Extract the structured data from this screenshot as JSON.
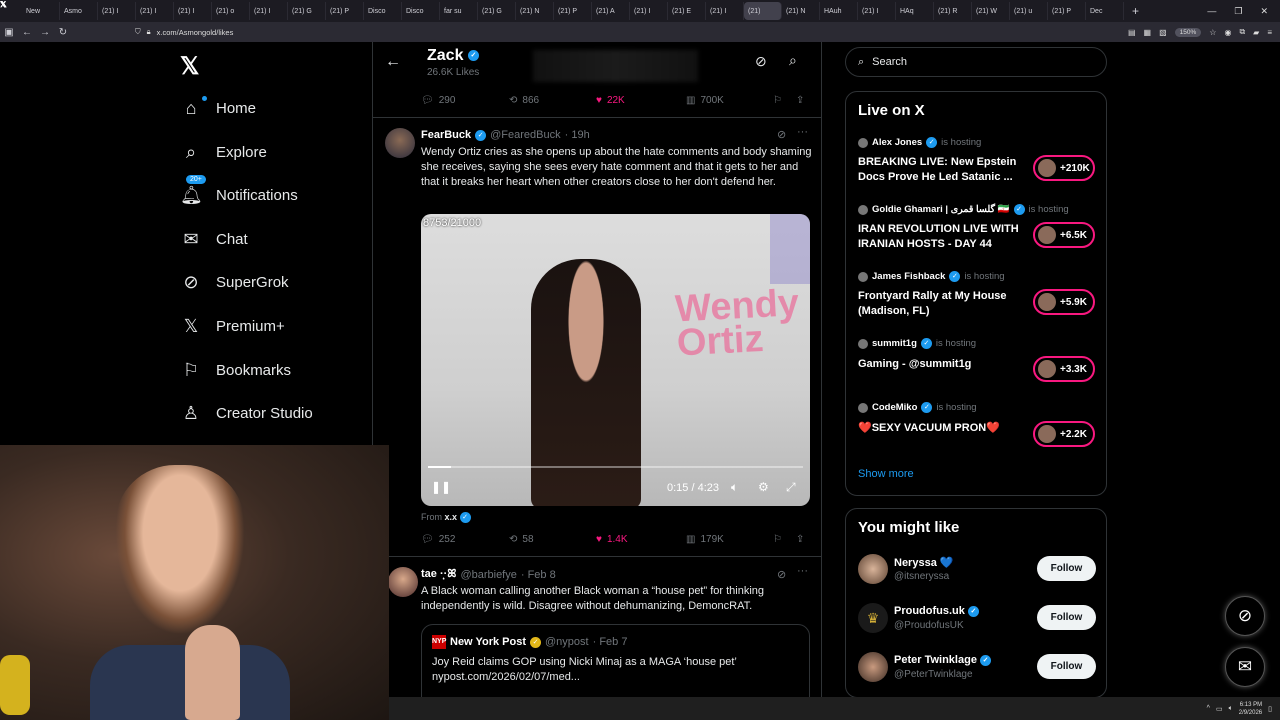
{
  "browser": {
    "tabs": [
      "New",
      "Asmo",
      "(21) I",
      "(21) I",
      "(21) I",
      "(21) o",
      "(21) I",
      "(21) G",
      "(21) P",
      "Disco",
      "Disco",
      "far su",
      "(21) G",
      "(21) N",
      "(21) P",
      "(21) A",
      "(21) I",
      "(21) E",
      "(21) I",
      "(21)",
      "(21) N",
      "HAuh",
      "(21) I",
      "HAq",
      "(21) R",
      "(21) W",
      "(21) u",
      "(21) P",
      "Dec"
    ],
    "active_tab_index": 19,
    "url": "x.com/Asmongold/likes",
    "zoom": "150%",
    "clock_time": "6:13 PM",
    "clock_date": "2/9/2026"
  },
  "sidebar": {
    "items": [
      {
        "label": "Home",
        "icon": "home-icon"
      },
      {
        "label": "Explore",
        "icon": "search-icon"
      },
      {
        "label": "Notifications",
        "icon": "bell-icon",
        "badge": "20+"
      },
      {
        "label": "Chat",
        "icon": "mail-icon"
      },
      {
        "label": "SuperGrok",
        "icon": "grok-icon"
      },
      {
        "label": "Premium+",
        "icon": "x-logo-icon"
      },
      {
        "label": "Bookmarks",
        "icon": "bookmark-icon"
      },
      {
        "label": "Creator Studio",
        "icon": "creator-icon"
      }
    ]
  },
  "header": {
    "name": "Zack",
    "subtitle": "26.6K Likes"
  },
  "top_actions": {
    "replies": "290",
    "reposts": "866",
    "likes": "22K",
    "views": "700K"
  },
  "tweet1": {
    "name": "FearBuck",
    "handle": "@FearedBuck",
    "time": "· 19h",
    "text": "Wendy Ortiz cries as she opens up about the hate comments and body shaming she receives, saying she sees every hate comment and that it gets to her and that it breaks her heart when other creators close to her don't defend her.",
    "video": {
      "counter": "8753/21000",
      "wall_text": "Wendy Ortiz",
      "time": "0:15 / 4:23",
      "progress": 0.06
    },
    "from_label": "From",
    "from_user": "x.x",
    "actions": {
      "replies": "252",
      "reposts": "58",
      "likes": "1.4K",
      "views": "179K"
    }
  },
  "tweet2": {
    "name": "tae ·̩͙·ꕤ",
    "handle": "@barbiefye",
    "time": "· Feb 8",
    "text": "A Black woman calling another Black woman a “house pet” for thinking independently is wild. Disagree without dehumanizing, DemoncRAT.",
    "quote": {
      "logo": "NYP",
      "name": "New York Post",
      "handle": "@nypost",
      "time": "· Feb 7",
      "text": "Joy Reid claims GOP using Nicki Minaj as a MAGA ‘house pet’ nypost.com/2026/02/07/med..."
    }
  },
  "right": {
    "search_placeholder": "Search",
    "live_title": "Live on X",
    "live": [
      {
        "host": "Alex Jones",
        "hosting": "is hosting",
        "title": "BREAKING LIVE: New Epstein Docs Prove He Led Satanic ...",
        "count": "+210K"
      },
      {
        "host": "Goldie Ghamari | گلسا قمری 🇮🇷",
        "hosting": "is hosting",
        "title": "IRAN REVOLUTION LIVE WITH IRANIAN HOSTS - DAY 44",
        "count": "+6.5K"
      },
      {
        "host": "James Fishback",
        "hosting": "is hosting",
        "title": "Frontyard Rally at My House (Madison, FL)",
        "count": "+5.9K"
      },
      {
        "host": "summit1g",
        "hosting": "is hosting",
        "title": "Gaming - @summit1g",
        "count": "+3.3K"
      },
      {
        "host": "CodeMiko",
        "hosting": "is hosting",
        "title": "❤️SEXY VACUUM PRON❤️",
        "count": "+2.2K"
      }
    ],
    "show_more": "Show more",
    "might_like_title": "You might like",
    "suggestions": [
      {
        "name": "Neryssa 💙",
        "handle": "@itsneryssa",
        "button": "Follow"
      },
      {
        "name": "Proudofus.uk",
        "handle": "@ProudofusUK",
        "button": "Follow"
      },
      {
        "name": "Peter Twinklage",
        "handle": "@PeterTwinklage",
        "button": "Follow"
      }
    ]
  },
  "colors": {
    "accent": "#1d9bf0",
    "like": "#f91880",
    "border": "#2f3336",
    "muted": "#71767b"
  }
}
